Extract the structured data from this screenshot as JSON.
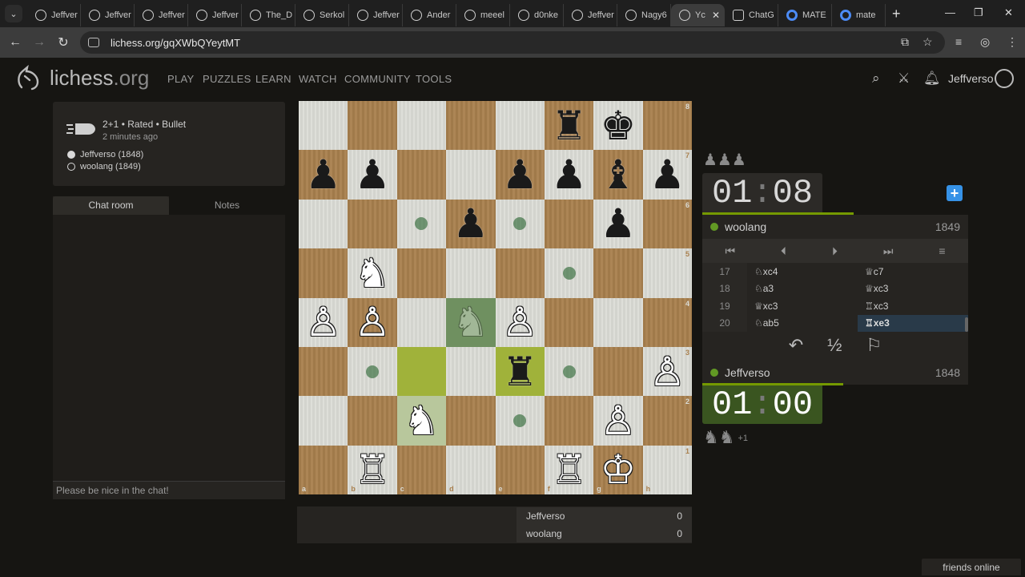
{
  "browser": {
    "tabs": [
      {
        "label": "Jeffver",
        "kind": "lichess"
      },
      {
        "label": "Jeffver",
        "kind": "lichess"
      },
      {
        "label": "Jeffver",
        "kind": "lichess"
      },
      {
        "label": "Jeffver",
        "kind": "lichess"
      },
      {
        "label": "The_D",
        "kind": "lichess"
      },
      {
        "label": "Serkol",
        "kind": "lichess"
      },
      {
        "label": "Jeffver",
        "kind": "lichess"
      },
      {
        "label": "Ander",
        "kind": "lichess"
      },
      {
        "label": "meeel",
        "kind": "lichess"
      },
      {
        "label": "d0nke",
        "kind": "lichess"
      },
      {
        "label": "Jeffver",
        "kind": "lichess"
      },
      {
        "label": "Nagy6",
        "kind": "lichess"
      },
      {
        "label": "Yc",
        "kind": "lichess",
        "active": true
      },
      {
        "label": "ChatG",
        "kind": "chatgpt"
      },
      {
        "label": "MATE",
        "kind": "google"
      },
      {
        "label": "mate",
        "kind": "google"
      }
    ],
    "url": "lichess.org/gqXWbQYeytMT"
  },
  "header": {
    "logo": "lichess",
    "logo_tld": ".org",
    "nav": [
      "PLAY",
      "PUZZLES",
      "LEARN",
      "WATCH",
      "COMMUNITY",
      "TOOLS"
    ],
    "username": "Jeffverso"
  },
  "game": {
    "setup": "2+1 • Rated • Bullet",
    "ago": "2 minutes ago",
    "white": "Jeffverso (1848)",
    "black": "woolang (1849)"
  },
  "chat": {
    "tab_chat": "Chat room",
    "tab_notes": "Notes",
    "placeholder": "Please be nice in the chat!"
  },
  "board": {
    "files": [
      "a",
      "b",
      "c",
      "d",
      "e",
      "f",
      "g",
      "h"
    ],
    "ranks": [
      "8",
      "7",
      "6",
      "5",
      "4",
      "3",
      "2",
      "1"
    ],
    "pieces": [
      {
        "sq": "f8",
        "p": "♜",
        "c": "b"
      },
      {
        "sq": "g8",
        "p": "♚",
        "c": "b"
      },
      {
        "sq": "a7",
        "p": "♟",
        "c": "b"
      },
      {
        "sq": "b7",
        "p": "♟",
        "c": "b"
      },
      {
        "sq": "e7",
        "p": "♟",
        "c": "b"
      },
      {
        "sq": "f7",
        "p": "♟",
        "c": "b"
      },
      {
        "sq": "g7",
        "p": "♝",
        "c": "b"
      },
      {
        "sq": "h7",
        "p": "♟",
        "c": "b"
      },
      {
        "sq": "d6",
        "p": "♟",
        "c": "b"
      },
      {
        "sq": "g6",
        "p": "♟",
        "c": "b"
      },
      {
        "sq": "b5",
        "p": "♞",
        "c": "w"
      },
      {
        "sq": "a4",
        "p": "♙",
        "c": "w"
      },
      {
        "sq": "b4",
        "p": "♙",
        "c": "w"
      },
      {
        "sq": "d4",
        "p": "♞",
        "c": "w",
        "ghost": true
      },
      {
        "sq": "e4",
        "p": "♙",
        "c": "w"
      },
      {
        "sq": "e3",
        "p": "♜",
        "c": "b"
      },
      {
        "sq": "h3",
        "p": "♙",
        "c": "w"
      },
      {
        "sq": "c2",
        "p": "♞",
        "c": "w"
      },
      {
        "sq": "g2",
        "p": "♙",
        "c": "w"
      },
      {
        "sq": "b1",
        "p": "♖",
        "c": "w"
      },
      {
        "sq": "f1",
        "p": "♖",
        "c": "w"
      },
      {
        "sq": "g1",
        "p": "♔",
        "c": "w"
      }
    ],
    "last_move": [
      "c3",
      "e3"
    ],
    "selected": [
      "d4",
      "c2"
    ],
    "destinations": [
      "c6",
      "e6",
      "f5",
      "b3",
      "f3",
      "e2"
    ]
  },
  "score": {
    "rows": [
      {
        "name": "Jeffverso",
        "value": "0"
      },
      {
        "name": "woolang",
        "value": "0"
      }
    ]
  },
  "right": {
    "top_material": "♟♟♟",
    "top_clock": {
      "min": "01",
      "sec": "08"
    },
    "top_bar_pct": 57,
    "top_player": {
      "name": "woolang",
      "rating": "1849"
    },
    "bottom_player": {
      "name": "Jeffverso",
      "rating": "1848"
    },
    "bottom_clock": {
      "min": "01",
      "sec": "00"
    },
    "bottom_bar_pct": 53,
    "bottom_material": "♞♞",
    "bottom_material_plus": "+1",
    "moves": [
      {
        "n": "17",
        "w": "♘xc4",
        "b": "♕c7"
      },
      {
        "n": "18",
        "w": "♘a3",
        "b": "♕xc3"
      },
      {
        "n": "19",
        "w": "♕xc3",
        "b": "♖xc3"
      },
      {
        "n": "20",
        "w": "♘ab5",
        "b": "♖xe3",
        "current": true
      }
    ],
    "draw_label": "½"
  },
  "footer": {
    "friends": "friends online"
  },
  "colors": {
    "accent": "#759900",
    "online": "#629924",
    "blue": "#3692e7"
  }
}
